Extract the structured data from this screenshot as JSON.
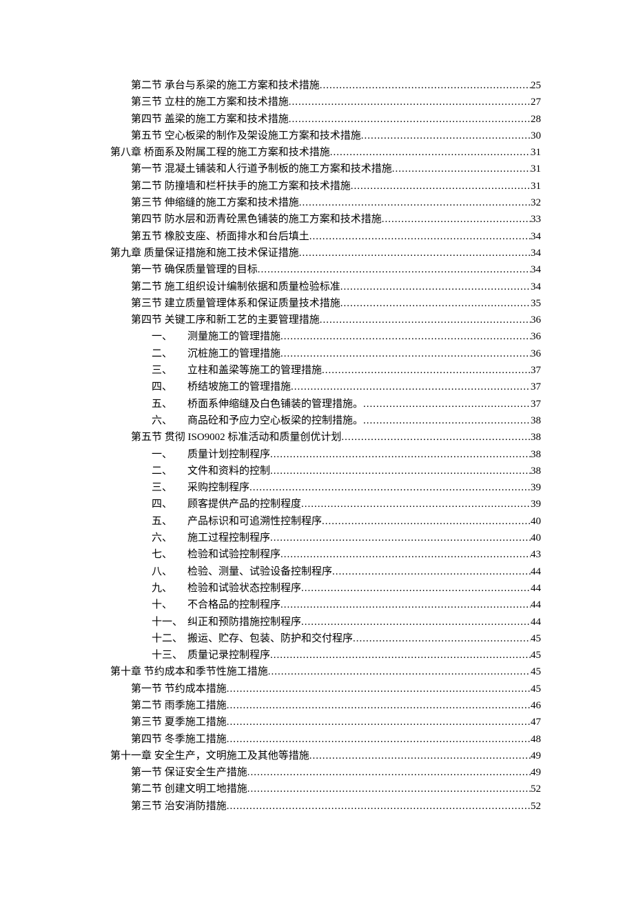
{
  "toc": [
    {
      "level": 2,
      "text": "第二节 承台与系梁的施工方案和技术措施",
      "page": "25"
    },
    {
      "level": 2,
      "text": "第三节 立柱的施工方案和技术措施",
      "page": "27"
    },
    {
      "level": 2,
      "text": "第四节 盖梁的施工方案和技术措施",
      "page": "28"
    },
    {
      "level": 2,
      "text": "第五节 空心板梁的制作及架设施工方案和技术措施",
      "page": "30"
    },
    {
      "level": 1,
      "text": "第八章 桥面系及附属工程的施工方案和技术措施",
      "page": "31"
    },
    {
      "level": 2,
      "text": "第一节 混凝土铺装和人行道予制板的施工方案和技术措施",
      "page": "31"
    },
    {
      "level": 2,
      "text": "第二节 防撞墙和栏杆扶手的施工方案和技术措施",
      "page": "31"
    },
    {
      "level": 2,
      "text": "第三节 伸缩缝的施工方案和技术措施",
      "page": "32"
    },
    {
      "level": 2,
      "text": "第四节 防水层和沥青砼黑色铺装的施工方案和技术措施",
      "page": "33"
    },
    {
      "level": 2,
      "text": "第五节 橡胶支座、桥面排水和台后填土",
      "page": "34"
    },
    {
      "level": 1,
      "text": "第九章 质量保证措施和施工技术保证措施",
      "page": "34"
    },
    {
      "level": 2,
      "text": "第一节 确保质量管理的目标",
      "page": "34"
    },
    {
      "level": 2,
      "text": "第二节 施工组织设计编制依据和质量检验标准",
      "page": "34"
    },
    {
      "level": 2,
      "text": "第三节 建立质量管理体系和保证质量技术措施",
      "page": "35"
    },
    {
      "level": 2,
      "text": "第四节 关键工序和新工艺的主要管理措施",
      "page": "36"
    },
    {
      "level": 3,
      "num": "一、",
      "text": "测量施工的管理措施",
      "page": "36"
    },
    {
      "level": 3,
      "num": "二、",
      "text": "沉桩施工的管理措施",
      "page": "36"
    },
    {
      "level": 3,
      "num": "三、",
      "text": "立柱和盖梁等施工的管理措施",
      "page": "37"
    },
    {
      "level": 3,
      "num": "四、",
      "text": "桥结坡施工的管理措施",
      "page": "37"
    },
    {
      "level": 3,
      "num": "五、",
      "text": "桥面系伸缩缝及白色铺装的管理措施。",
      "page": "37"
    },
    {
      "level": 3,
      "num": "六、",
      "text": "商品砼和予应力空心板梁的控制措施。",
      "page": "38"
    },
    {
      "level": 2,
      "text": "第五节 贯彻 ISO9002 标准活动和质量创优计划",
      "page": "38"
    },
    {
      "level": 3,
      "num": "一、",
      "text": "质量计划控制程序",
      "page": "38"
    },
    {
      "level": 3,
      "num": "二、",
      "text": "文件和资料的控制",
      "page": "38"
    },
    {
      "level": 3,
      "num": "三、",
      "text": "采购控制程序",
      "page": "39"
    },
    {
      "level": 3,
      "num": "四、",
      "text": "顾客提供产品的控制程度",
      "page": "39"
    },
    {
      "level": 3,
      "num": "五、",
      "text": "产品标识和可追溯性控制程序",
      "page": "40"
    },
    {
      "level": 3,
      "num": "六、",
      "text": "施工过程控制程序",
      "page": "40"
    },
    {
      "level": 3,
      "num": "七、",
      "text": "检验和试验控制程序",
      "page": "43"
    },
    {
      "level": 3,
      "num": "八、",
      "text": "检验、测量、试验设备控制程序",
      "page": "44"
    },
    {
      "level": 3,
      "num": "九、",
      "text": "检验和试验状态控制程序",
      "page": "44"
    },
    {
      "level": 3,
      "num": "十、",
      "text": "不合格品的控制程序",
      "page": "44"
    },
    {
      "level": 3,
      "num": "十一、",
      "text": "纠正和预防措施控制程序",
      "page": "44"
    },
    {
      "level": 3,
      "num": "十二、",
      "text": "搬运、贮存、包装、防护和交付程序",
      "page": "45"
    },
    {
      "level": 3,
      "num": "十三、",
      "text": "质量记录控制程序",
      "page": "45"
    },
    {
      "level": 1,
      "text": "第十章 节约成本和季节性施工措施",
      "page": "45"
    },
    {
      "level": 2,
      "text": "第一节 节约成本措施",
      "page": "45"
    },
    {
      "level": 2,
      "text": "第二节 雨季施工措施",
      "page": "46"
    },
    {
      "level": 2,
      "text": "第三节 夏季施工措施",
      "page": "47"
    },
    {
      "level": 2,
      "text": "第四节 冬季施工措施",
      "page": "48"
    },
    {
      "level": 1,
      "text": "第十一章 安全生产，文明施工及其他等措施",
      "page": "49"
    },
    {
      "level": 2,
      "text": "第一节 保证安全生产措施",
      "page": "49"
    },
    {
      "level": 2,
      "text": "第二节 创建文明工地措施",
      "page": "52"
    },
    {
      "level": 2,
      "text": "第三节 治安消防措施",
      "page": "52"
    }
  ]
}
